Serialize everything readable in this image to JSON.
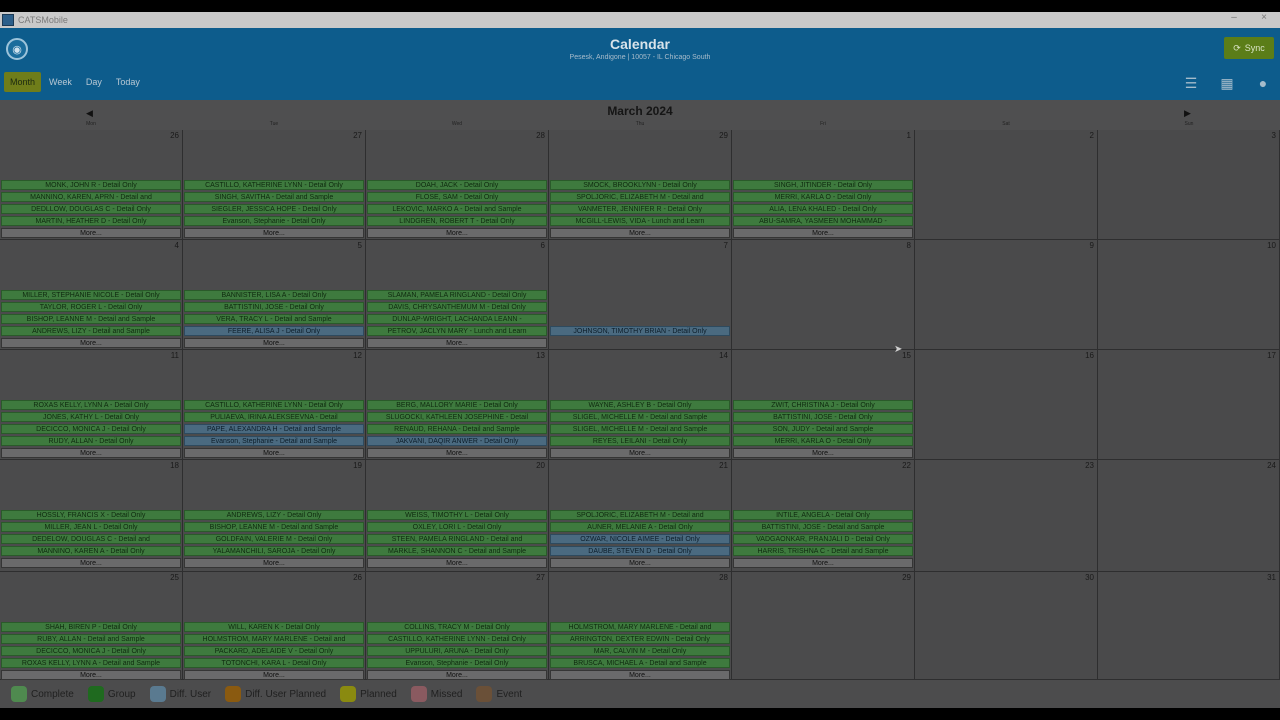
{
  "window": {
    "title": "CATSMobile",
    "minimize": "–",
    "close": "×"
  },
  "header": {
    "title": "Calendar",
    "subtitle": "Pesesk, Andigone | 10057 - IL Chicago South",
    "sync_label": "Sync"
  },
  "view_tabs": [
    {
      "label": "Month",
      "active": true
    },
    {
      "label": "Week"
    },
    {
      "label": "Day"
    },
    {
      "label": "Today"
    }
  ],
  "month_title": "March 2024",
  "weekdays": [
    "Mon",
    "Tue",
    "Wed",
    "Thu",
    "Fri",
    "Sat",
    "Sun"
  ],
  "more_label": "More...",
  "weeks": [
    {
      "days": [
        {
          "num": "26",
          "events": [
            [
              "MONK, JOHN R - Detail Only",
              "c"
            ],
            [
              "MANNINO, KAREN, APRN - Detail and",
              "c"
            ],
            [
              "DEDLLOW, DOUGLAS C - Detail Only",
              "c"
            ],
            [
              "MARTIN, HEATHER D - Detail Only",
              "c"
            ]
          ],
          "more": true
        },
        {
          "num": "27",
          "events": [
            [
              "CASTILLO, KATHERINE LYNN - Detail Only",
              "c"
            ],
            [
              "SINGH, SAVITHA - Detail and Sample",
              "c"
            ],
            [
              "SIEGLER, JESSICA HOPE - Detail Only",
              "c"
            ],
            [
              "Evanson, Stephanie - Detail Only",
              "c"
            ]
          ],
          "more": true
        },
        {
          "num": "28",
          "events": [
            [
              "DOAH, JACK - Detail Only",
              "c"
            ],
            [
              "FLOSE, SAM - Detail Only",
              "c"
            ],
            [
              "LEKOVIC, MARKO A - Detail and Sample",
              "c"
            ],
            [
              "LINDGREN, ROBERT T - Detail Only",
              "c"
            ]
          ],
          "more": true
        },
        {
          "num": "29",
          "events": [
            [
              "SMOCK, BROOKLYNN - Detail Only",
              "c"
            ],
            [
              "SPOLJORIC, ELIZABETH M - Detail and",
              "c"
            ],
            [
              "VANMETER, JENNIFER R - Detail Only",
              "c"
            ],
            [
              "MCGILL-LEWIS, VIDA - Lunch and Learn",
              "c"
            ]
          ],
          "more": true
        },
        {
          "num": "1",
          "events": [
            [
              "SINGH, JITINDER - Detail Only",
              "c"
            ],
            [
              "MERRI, KARLA O - Detail Only",
              "c"
            ],
            [
              "ALIA, LENA KHALED - Detail Only",
              "c"
            ],
            [
              "ABU-SAMRA, YASMEEN MOHAMMAD -",
              "c"
            ]
          ],
          "more": true
        },
        {
          "num": "2",
          "events": [],
          "more": false
        },
        {
          "num": "3",
          "events": [],
          "more": false
        }
      ]
    },
    {
      "days": [
        {
          "num": "4",
          "events": [
            [
              "MILLER, STEPHANIE NICOLE - Detail Only",
              "c"
            ],
            [
              "TAYLOR, ROGER L - Detail Only",
              "c"
            ],
            [
              "BISHOP, LEANNE M - Detail and Sample",
              "c"
            ],
            [
              "ANDREWS, LIZY - Detail and Sample",
              "c"
            ]
          ],
          "more": true
        },
        {
          "num": "5",
          "events": [
            [
              "BANNISTER, LISA A - Detail Only",
              "c"
            ],
            [
              "BATTISTINI, JOSE - Detail Only",
              "c"
            ],
            [
              "VERA, TRACY L - Detail and Sample",
              "c"
            ],
            [
              "FEERE, ALISA J - Detail Only",
              "d"
            ]
          ],
          "more": true
        },
        {
          "num": "6",
          "events": [
            [
              "SLAMAN, PAMELA RINGLAND - Detail Only",
              "c"
            ],
            [
              "DAVIS, CHRYSANTHEMUM M - Detail Only",
              "c"
            ],
            [
              "DUNLAP-WRIGHT, LACHANDA LEANN -",
              "c"
            ],
            [
              "PETROV, JACLYN MARY - Lunch and Learn",
              "c"
            ]
          ],
          "more": true
        },
        {
          "num": "7",
          "events": [
            [
              "",
              "x"
            ],
            [
              "",
              "x"
            ],
            [
              "",
              "x"
            ],
            [
              "JOHNSON, TIMOTHY BRIAN - Detail Only",
              "d"
            ]
          ],
          "more": false
        },
        {
          "num": "8",
          "events": [],
          "more": false
        },
        {
          "num": "9",
          "events": [],
          "more": false
        },
        {
          "num": "10",
          "events": [],
          "more": false
        }
      ]
    },
    {
      "days": [
        {
          "num": "11",
          "events": [
            [
              "ROXAS KELLY, LYNN A - Detail Only",
              "c"
            ],
            [
              "JONES, KATHY L - Detail Only",
              "c"
            ],
            [
              "DECICCO, MONICA J - Detail Only",
              "c"
            ],
            [
              "RUDY, ALLAN - Detail Only",
              "c"
            ]
          ],
          "more": true
        },
        {
          "num": "12",
          "events": [
            [
              "CASTILLO, KATHERINE LYNN - Detail Only",
              "c"
            ],
            [
              "PULIAEVA, IRINA ALEKSEEVNA - Detail",
              "c"
            ],
            [
              "PAPE, ALEXANDRA H - Detail and Sample",
              "d"
            ],
            [
              "Evanson, Stephanie - Detail and Sample",
              "d"
            ]
          ],
          "more": true
        },
        {
          "num": "13",
          "events": [
            [
              "BERG, MALLORY MARIE - Detail Only",
              "c"
            ],
            [
              "SLUGOCKI, KATHLEEN JOSEPHINE - Detail",
              "c"
            ],
            [
              "RENAUD, REHANA - Detail and Sample",
              "c"
            ],
            [
              "JAKVANI, DAQIR ANWER - Detail Only",
              "d"
            ]
          ],
          "more": true
        },
        {
          "num": "14",
          "events": [
            [
              "WAYNE, ASHLEY B - Detail Only",
              "c"
            ],
            [
              "SLIGEL, MICHELLE M - Detail and Sample",
              "c"
            ],
            [
              "SLIGEL, MICHELLE M - Detail and Sample",
              "c"
            ],
            [
              "REYES, LEILANI - Detail Only",
              "c"
            ]
          ],
          "more": true
        },
        {
          "num": "15",
          "events": [
            [
              "ZWIT, CHRISTINA J - Detail Only",
              "c"
            ],
            [
              "BATTISTINI, JOSE - Detail Only",
              "c"
            ],
            [
              "SON, JUDY - Detail and Sample",
              "c"
            ],
            [
              "MERRI, KARLA O - Detail Only",
              "c"
            ]
          ],
          "more": true
        },
        {
          "num": "16",
          "events": [],
          "more": false
        },
        {
          "num": "17",
          "events": [],
          "more": false
        }
      ]
    },
    {
      "days": [
        {
          "num": "18",
          "events": [
            [
              "HOSSLY, FRANCIS X - Detail Only",
              "c"
            ],
            [
              "MILLER, JEAN L - Detail Only",
              "c"
            ],
            [
              "DEDELOW, DOUGLAS C - Detail and",
              "c"
            ],
            [
              "MANNINO, KAREN A - Detail Only",
              "c"
            ]
          ],
          "more": true
        },
        {
          "num": "19",
          "events": [
            [
              "ANDREWS, LIZY - Detail Only",
              "c"
            ],
            [
              "BISHOP, LEANNE M - Detail and Sample",
              "c"
            ],
            [
              "GOLDFAIN, VALERIE M - Detail Only",
              "c"
            ],
            [
              "YALAMANCHILI, SAROJA - Detail Only",
              "c"
            ]
          ],
          "more": true
        },
        {
          "num": "20",
          "events": [
            [
              "WEISS, TIMOTHY L - Detail Only",
              "c"
            ],
            [
              "OXLEY, LORI L - Detail Only",
              "c"
            ],
            [
              "STEEN, PAMELA RINGLAND - Detail and",
              "c"
            ],
            [
              "MARKLE, SHANNON C - Detail and Sample",
              "c"
            ]
          ],
          "more": true
        },
        {
          "num": "21",
          "events": [
            [
              "SPOLJORIC, ELIZABETH M - Detail and",
              "c"
            ],
            [
              "AUNER, MELANIE A - Detail Only",
              "c"
            ],
            [
              "OZWAR, NICOLE AIMEE - Detail Only",
              "d"
            ],
            [
              "DAUBE, STEVEN D - Detail Only",
              "d"
            ]
          ],
          "more": true
        },
        {
          "num": "22",
          "events": [
            [
              "INTILE, ANGELA - Detail Only",
              "c"
            ],
            [
              "BATTISTINI, JOSE - Detail and Sample",
              "c"
            ],
            [
              "VADGAONKAR, PRANJALI D - Detail Only",
              "c"
            ],
            [
              "HARRIS, TRISHNA C - Detail and Sample",
              "c"
            ]
          ],
          "more": true
        },
        {
          "num": "23",
          "events": [],
          "more": false
        },
        {
          "num": "24",
          "events": [],
          "more": false
        }
      ]
    },
    {
      "days": [
        {
          "num": "25",
          "events": [
            [
              "SHAH, BIREN P - Detail Only",
              "c"
            ],
            [
              "RUBY, ALLAN - Detail and Sample",
              "c"
            ],
            [
              "DECICCO, MONICA J - Detail Only",
              "c"
            ],
            [
              "ROXAS KELLY, LYNN A - Detail and Sample",
              "c"
            ]
          ],
          "more": true
        },
        {
          "num": "26",
          "events": [
            [
              "WILL, KAREN K - Detail Only",
              "c"
            ],
            [
              "HOLMSTROM, MARY MARLENE - Detail and",
              "c"
            ],
            [
              "PACKARD, ADELAIDE V - Detail Only",
              "c"
            ],
            [
              "TOTONCHI, KARA L - Detail Only",
              "c"
            ]
          ],
          "more": true
        },
        {
          "num": "27",
          "events": [
            [
              "COLLINS, TRACY M - Detail Only",
              "c"
            ],
            [
              "CASTILLO, KATHERINE LYNN - Detail Only",
              "c"
            ],
            [
              "UPPULURI, ARUNA - Detail Only",
              "c"
            ],
            [
              "Evanson, Stephanie - Detail Only",
              "c"
            ]
          ],
          "more": true
        },
        {
          "num": "28",
          "events": [
            [
              "HOLMSTROM, MARY MARLENE - Detail and",
              "c"
            ],
            [
              "ARRINGTON, DEXTER EDWIN - Detail Only",
              "c"
            ],
            [
              "MAR, CALVIN M - Detail Only",
              "c"
            ],
            [
              "BRUSCA, MICHAEL A - Detail and Sample",
              "c"
            ]
          ],
          "more": true
        },
        {
          "num": "29",
          "events": [],
          "more": false
        },
        {
          "num": "30",
          "events": [],
          "more": false
        },
        {
          "num": "31",
          "events": [],
          "more": false
        }
      ]
    }
  ],
  "legend": [
    {
      "label": "Complete",
      "color": "#4f8a4f"
    },
    {
      "label": "Group",
      "color": "#1f6a1f"
    },
    {
      "label": "Diff. User",
      "color": "#5a7a90"
    },
    {
      "label": "Diff. User Planned",
      "color": "#8a5a10"
    },
    {
      "label": "Planned",
      "color": "#8a8a10"
    },
    {
      "label": "Missed",
      "color": "#8a5a60"
    },
    {
      "label": "Event",
      "color": "#6a5038"
    }
  ]
}
